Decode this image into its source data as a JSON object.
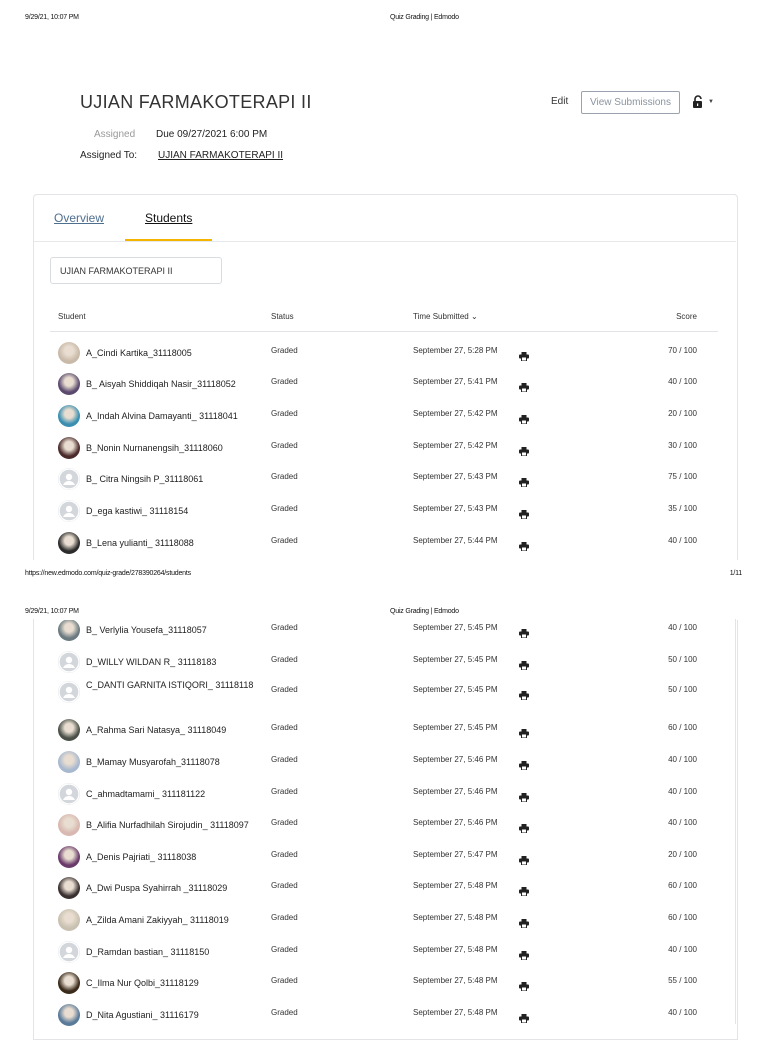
{
  "print_header_1": {
    "datetime": "9/29/21, 10:07 PM",
    "page_title": "Quiz Grading | Edmodo"
  },
  "print_footer_1": {
    "url": "https://new.edmodo.com/quiz-grade/278390264/students",
    "page_no": "1/11"
  },
  "print_header_2": {
    "datetime": "9/29/21, 10:07 PM",
    "page_title": "Quiz Grading | Edmodo"
  },
  "quiz": {
    "title": "UJIAN FARMAKOTERAPI II",
    "edit_label": "Edit",
    "view_submissions_label": "View Submissions",
    "assigned_label": "Assigned",
    "due_text": "Due 09/27/2021 6:00 PM",
    "assigned_to_label": "Assigned To:",
    "assigned_to_value": "UJIAN FARMAKOTERAPI II"
  },
  "tabs": [
    {
      "label": "Overview"
    },
    {
      "label": "Students"
    }
  ],
  "filter": {
    "value": "UJIAN FARMAKOTERAPI II"
  },
  "columns": {
    "student": "Student",
    "status": "Status",
    "time": "Time Submitted",
    "score": "Score"
  },
  "rows": [
    {
      "name": "A_Cindi Kartika_31118005",
      "status": "Graded",
      "time": "September 27, 5:28 PM",
      "score": "70 / 100",
      "avatar": "photo",
      "color": "#c9b9a8"
    },
    {
      "name": "B_ Aisyah Shiddiqah Nasir_31118052",
      "status": "Graded",
      "time": "September 27, 5:41 PM",
      "score": "40 / 100",
      "avatar": "photo",
      "color": "#5b4a6e"
    },
    {
      "name": "A_Indah Alvina Damayanti_ 31118041",
      "status": "Graded",
      "time": "September 27, 5:42 PM",
      "score": "20 / 100",
      "avatar": "photo",
      "color": "#3a8fb0"
    },
    {
      "name": "B_Nonin Nurnanengsih_31118060",
      "status": "Graded",
      "time": "September 27, 5:42 PM",
      "score": "30 / 100",
      "avatar": "photo",
      "color": "#4a2a2a"
    },
    {
      "name": "B_ Citra Ningsih P_31118061",
      "status": "Graded",
      "time": "September 27, 5:43 PM",
      "score": "75 / 100",
      "avatar": "default",
      "color": "#d3d7db"
    },
    {
      "name": "D_ega kastiwi_ 31118154",
      "status": "Graded",
      "time": "September 27, 5:43 PM",
      "score": "35 / 100",
      "avatar": "default",
      "color": "#d3d7db"
    },
    {
      "name": "B_Lena yulianti_ 31118088",
      "status": "Graded",
      "time": "September 27, 5:44 PM",
      "score": "40 / 100",
      "avatar": "photo",
      "color": "#2b2b2b"
    },
    {
      "name": "B_ Verlylia Yousefa_31118057",
      "status": "Graded",
      "time": "September 27, 5:45 PM",
      "score": "40 / 100",
      "avatar": "photo",
      "color": "#6b7a80"
    },
    {
      "name": "D_WILLY WILDAN R_ 31118183",
      "status": "Graded",
      "time": "September 27, 5:45 PM",
      "score": "50 / 100",
      "avatar": "default",
      "color": "#d3d7db"
    },
    {
      "name": "C_DANTI GARNITA ISTIQORI_ 31118118",
      "status": "Graded",
      "time": "September 27, 5:45 PM",
      "score": "50 / 100",
      "avatar": "default",
      "color": "#d3d7db",
      "two": true
    },
    {
      "name": "A_Rahma Sari Natasya_ 31118049",
      "status": "Graded",
      "time": "September 27, 5:45 PM",
      "score": "60 / 100",
      "avatar": "photo",
      "color": "#4a5048"
    },
    {
      "name": "B_Mamay Musyarofah_31118078",
      "status": "Graded",
      "time": "September 27, 5:46 PM",
      "score": "40 / 100",
      "avatar": "photo",
      "color": "#a8b8cf"
    },
    {
      "name": "C_ahmadtamami_ 311181122",
      "status": "Graded",
      "time": "September 27, 5:46 PM",
      "score": "40 / 100",
      "avatar": "default",
      "color": "#d3d7db"
    },
    {
      "name": "B_Alifia Nurfadhilah Sirojudin_ 31118097",
      "status": "Graded",
      "time": "September 27, 5:46 PM",
      "score": "40 / 100",
      "avatar": "photo",
      "color": "#d8b8b0"
    },
    {
      "name": "A_Denis Pajriati_ 31118038",
      "status": "Graded",
      "time": "September 27, 5:47 PM",
      "score": "20 / 100",
      "avatar": "photo",
      "color": "#6a3a6a"
    },
    {
      "name": "A_Dwi Puspa Syahirrah _31118029",
      "status": "Graded",
      "time": "September 27, 5:48 PM",
      "score": "60 / 100",
      "avatar": "photo",
      "color": "#3a3030"
    },
    {
      "name": "A_Zilda Amani Zakiyyah_ 31118019",
      "status": "Graded",
      "time": "September 27, 5:48 PM",
      "score": "60 / 100",
      "avatar": "photo",
      "color": "#c8c0b0"
    },
    {
      "name": "D_Ramdan bastian_ 31118150",
      "status": "Graded",
      "time": "September 27, 5:48 PM",
      "score": "40 / 100",
      "avatar": "default",
      "color": "#d3d7db"
    },
    {
      "name": "C_Ilma Nur Qolbi_31118129",
      "status": "Graded",
      "time": "September 27, 5:48 PM",
      "score": "55 / 100",
      "avatar": "photo",
      "color": "#3a2a1a"
    },
    {
      "name": "D_Nita Agustiani_ 31116179",
      "status": "Graded",
      "time": "September 27, 5:48 PM",
      "score": "40 / 100",
      "avatar": "photo",
      "color": "#5a7a9a"
    }
  ]
}
